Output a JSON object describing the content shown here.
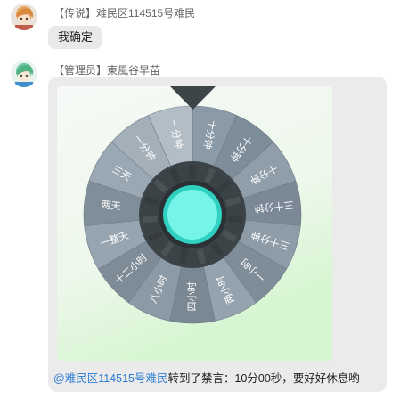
{
  "messages": [
    {
      "avatar_icon": "anime-girl-orange-hair-avatar",
      "sender_tag": "【传说】",
      "sender_name": "难民区114515号难民",
      "text": "我确定"
    },
    {
      "avatar_icon": "anime-girl-green-hair-avatar",
      "sender_tag": "【管理员】",
      "sender_name": "東風谷早苗",
      "wheel": {
        "pointer_icon": "triangle-pointer-icon",
        "hub_icon": "cyan-hub-icon",
        "segments": [
          {
            "label": "十分钟",
            "color": "#8a9aa6"
          },
          {
            "label": "十分钟",
            "color": "#7d8d99"
          },
          {
            "label": "十分钟",
            "color": "#909ea9"
          },
          {
            "label": "三十分钟",
            "color": "#7b8996"
          },
          {
            "label": "三十分钟",
            "color": "#8e9ca8"
          },
          {
            "label": "一小时",
            "color": "#7f8d99"
          },
          {
            "label": "两小时",
            "color": "#95a3ae"
          },
          {
            "label": "四小时",
            "color": "#7a8894"
          },
          {
            "label": "八小时",
            "color": "#8c9aa6"
          },
          {
            "label": "十二小时",
            "color": "#7e8c98"
          },
          {
            "label": "一整天",
            "color": "#97a5b0"
          },
          {
            "label": "两天",
            "color": "#808e9a"
          },
          {
            "label": "三天",
            "color": "#9aa8b3"
          },
          {
            "label": "一分钟",
            "color": "#a3b0ba"
          },
          {
            "label": "一分钟",
            "color": "#b2bdc6"
          }
        ]
      },
      "caption": {
        "mention": "@难民区114515号难民",
        "text": "转到了禁言：10分00秒，要好好休息哟"
      }
    }
  ],
  "colors": {
    "hub": "#73f2e6",
    "hub_ring": "#2fd0c0",
    "mention": "#2a7bd3",
    "wheel_bg_top": "#f4f8f4",
    "wheel_bg_bottom": "#d8f6d4"
  }
}
